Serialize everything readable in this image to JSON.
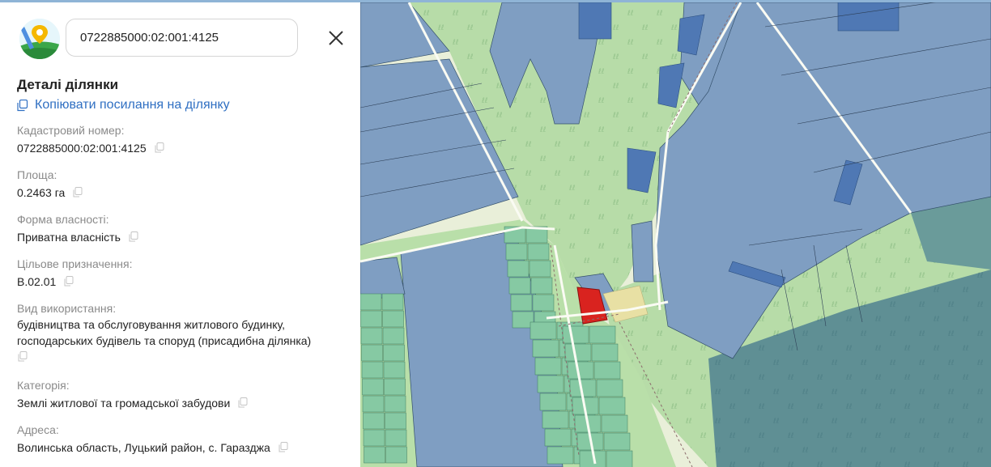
{
  "search": {
    "value": "0722885000:02:001:4125"
  },
  "panel": {
    "title": "Деталі ділянки",
    "copy_link_label": "Копіювати посилання на ділянку",
    "fields": [
      {
        "label": "Кадастровий номер:",
        "value": "0722885000:02:001:4125"
      },
      {
        "label": "Площа:",
        "value": "0.2463 га"
      },
      {
        "label": "Форма власності:",
        "value": "Приватна власність"
      },
      {
        "label": "Цільове призначення:",
        "value": "B.02.01"
      },
      {
        "label": "Вид використання:",
        "value": "будівництва та обслуговування житлового будинку, господарських будівель та споруд (присадибна ділянка)"
      },
      {
        "label": "Категорія:",
        "value": "Землі житлової та громадської забудови"
      },
      {
        "label": "Адреса:",
        "value": "Волинська область, Луцький район, с. Гаразджа"
      }
    ]
  },
  "colors": {
    "accent": "#2f6fc2",
    "selected_parcel": "#d9231f",
    "forest": "#b7dca8",
    "parcel_blue": "#7f9ec2",
    "parcel_green": "#86c9a3",
    "dark_forest": "#5f8f94"
  },
  "icons": [
    "map-pin-logo",
    "close-icon",
    "copy-icon"
  ]
}
